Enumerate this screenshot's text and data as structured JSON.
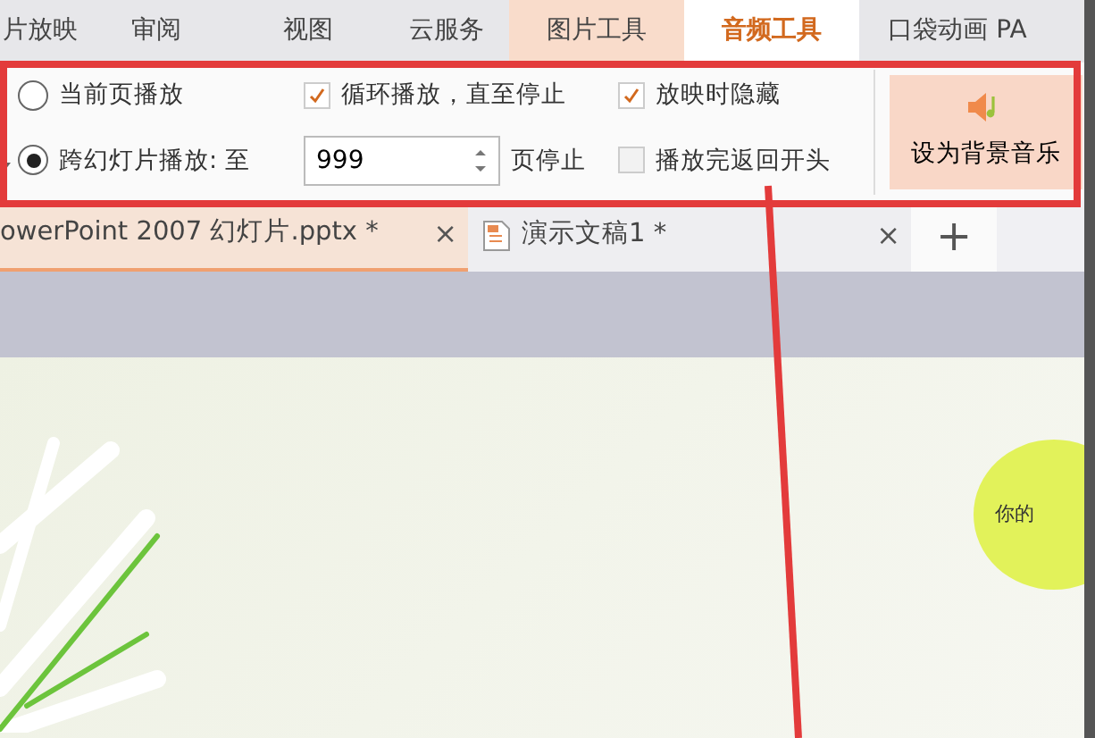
{
  "ribbon_tabs": [
    {
      "label": "片放映",
      "kind": "normal",
      "selected": false
    },
    {
      "label": "审阅",
      "kind": "normal",
      "selected": false
    },
    {
      "label": "视图",
      "kind": "normal",
      "selected": false
    },
    {
      "label": "云服务",
      "kind": "normal",
      "selected": false
    },
    {
      "label": "图片工具",
      "kind": "contextual",
      "selected": false
    },
    {
      "label": "音频工具",
      "kind": "contextual",
      "selected": true
    },
    {
      "label": "口袋动画 PA",
      "kind": "normal",
      "selected": false
    }
  ],
  "play_options": [
    {
      "label": "当前页播放",
      "selected": false
    },
    {
      "label": "跨幻灯片播放: 至",
      "selected": true
    }
  ],
  "stop_page": {
    "value": "999",
    "suffix": "页停止"
  },
  "checkboxes": [
    {
      "label": "循环播放，直至停止",
      "checked": true
    },
    {
      "label": "放映时隐藏",
      "checked": true
    },
    {
      "label": "播放完返回开头",
      "checked": false
    }
  ],
  "background_music_button": "设为背景音乐",
  "document_tabs": [
    {
      "label": "owerPoint 2007 幻灯片.pptx *",
      "selected": true,
      "close": "×"
    },
    {
      "label": "演示文稿1 *",
      "selected": false,
      "close": "×"
    }
  ],
  "new_tab": "+",
  "slide": {
    "bubble_text": "你的"
  }
}
